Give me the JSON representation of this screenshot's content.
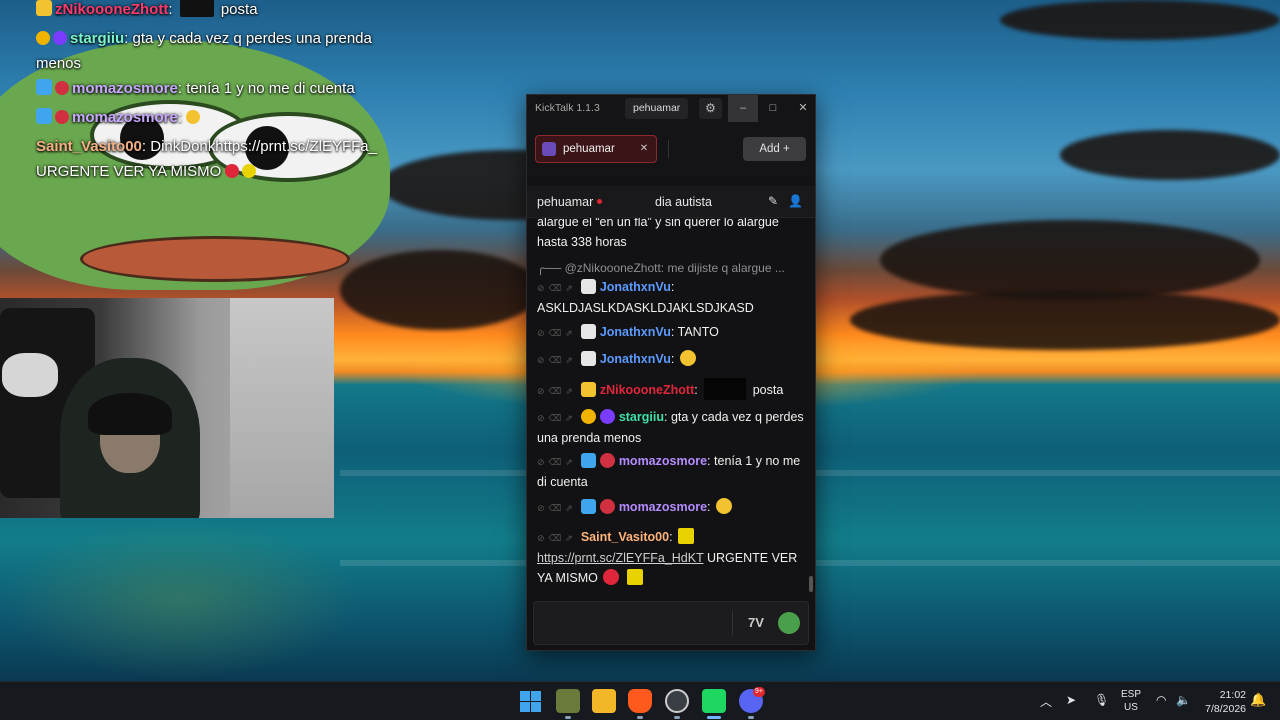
{
  "overlay_chat": [
    {
      "user": "zNikoooneZhott",
      "user_color": "#ff3a6e",
      "sep": ":",
      "text": "posta"
    },
    {
      "user": "stargiiu",
      "user_color": "#7cf3c8",
      "sep": ":",
      "text": "gta y cada vez q perdes una prenda menos"
    },
    {
      "user": "momazosmore",
      "user_color": "#c8a8ff",
      "sep": ":",
      "text": "tenía 1 y no me di cuenta"
    },
    {
      "user": "momazosmore",
      "user_color": "#c8a8ff",
      "sep": ":",
      "text": ""
    },
    {
      "user": "Saint_Vasito00",
      "user_color": "#f4b183",
      "sep": ":",
      "text": "DinkDonkhttps://prnt.sc/ZlEYFFa_ URGENTE VER YA MISMO"
    }
  ],
  "window": {
    "app_title": "KickTalk 1.1.3",
    "user_button": "pehuamar",
    "minimize": "–",
    "maximize": "□",
    "close": "✕"
  },
  "tabs": {
    "active": {
      "label": "pehuamar",
      "close": "✕"
    },
    "add_label": "Add +"
  },
  "channel": {
    "name": "pehuamar",
    "stream_title": "dia autista"
  },
  "chat": {
    "continued": {
      "text": "alargue el “en un fla” y sin querer lo alargue hasta 338 horas"
    },
    "reply": {
      "text": "@zNikoooneZhott: me dijiste q alargue ..."
    },
    "messages": [
      {
        "user": "JonathxnVu",
        "user_color": "#5b9bff",
        "sep": ":",
        "text": "ASKLDJASLKDASKLDJAKLSDJKASD"
      },
      {
        "user": "JonathxnVu",
        "user_color": "#5b9bff",
        "sep": ":",
        "text": "TANTO"
      },
      {
        "user": "JonathxnVu",
        "user_color": "#5b9bff",
        "sep": ":",
        "text": ""
      },
      {
        "user": "zNikoooneZhott",
        "user_color": "#e0263a",
        "sep": ":",
        "text": "posta"
      },
      {
        "user": "stargiiu",
        "user_color": "#3fe0a6",
        "sep": ":",
        "text": "gta y cada vez q perdes una prenda menos"
      },
      {
        "user": "momazosmore",
        "user_color": "#b48cff",
        "sep": ":",
        "text": "tenía 1 y no me di cuenta"
      },
      {
        "user": "momazosmore",
        "user_color": "#b48cff",
        "sep": ":",
        "text": ""
      },
      {
        "user": "Saint_Vasito00",
        "user_color": "#ffb37a",
        "sep": ":",
        "link": "https://prnt.sc/ZlEYFFa_HdKT",
        "text": "URGENTE VER YA MISMO"
      }
    ]
  },
  "input": {
    "placeholder": ""
  },
  "taskbar": {
    "lang_top": "ESP",
    "lang_bottom": "US",
    "time": "21:02",
    "date": "7/8/2026",
    "discord_badge": "9+"
  }
}
